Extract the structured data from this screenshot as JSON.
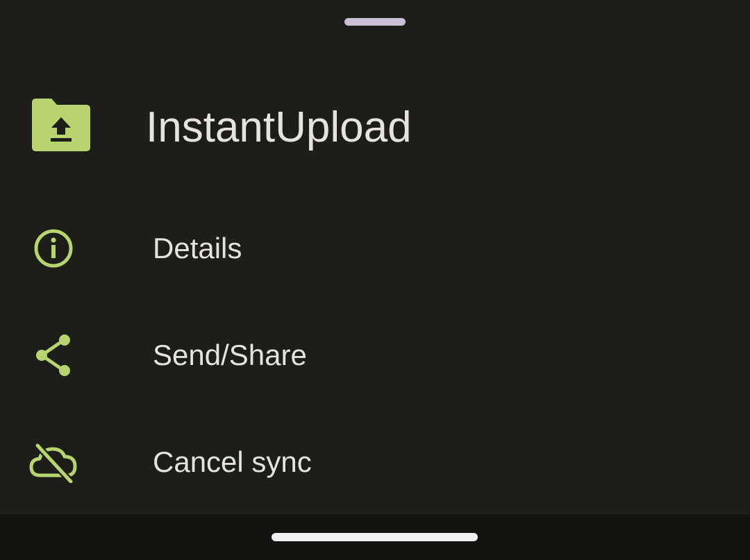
{
  "sheet": {
    "title": "InstantUpload",
    "title_icon": "folder-upload-icon",
    "actions": [
      {
        "label": "Details",
        "icon": "info-icon"
      },
      {
        "label": "Send/Share",
        "icon": "share-icon"
      },
      {
        "label": "Cancel sync",
        "icon": "cloud-off-icon"
      }
    ]
  },
  "colors": {
    "background": "#1d1e1a",
    "accent": "#b8d46e",
    "text": "#e5e3dc",
    "handle": "#c9c0d3",
    "navbar": "#131412"
  }
}
